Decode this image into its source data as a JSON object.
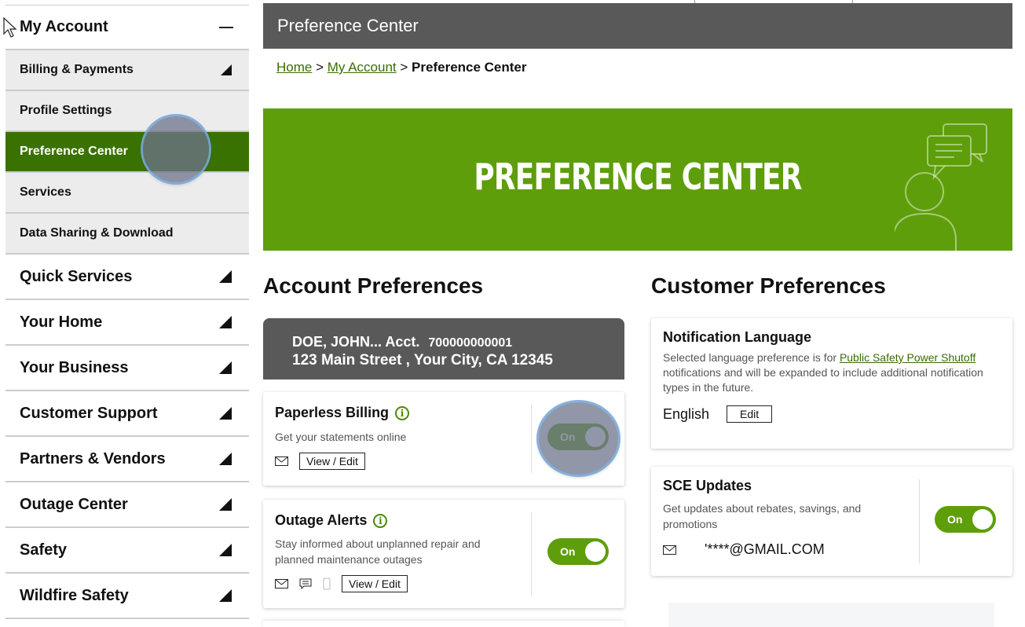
{
  "sidebar": {
    "account_title": "My Account",
    "sub_items": [
      {
        "label": "Billing & Payments"
      },
      {
        "label": "Profile Settings"
      },
      {
        "label": "Preference Center"
      },
      {
        "label": "Services"
      },
      {
        "label": "Data Sharing & Download"
      }
    ],
    "main_items": [
      {
        "label": "Quick Services"
      },
      {
        "label": "Your Home"
      },
      {
        "label": "Your Business"
      },
      {
        "label": "Customer Support"
      },
      {
        "label": "Partners & Vendors"
      },
      {
        "label": "Outage Center"
      },
      {
        "label": "Safety"
      },
      {
        "label": "Wildfire Safety"
      }
    ]
  },
  "header": {
    "title": "Preference Center"
  },
  "breadcrumb": {
    "home": "Home",
    "sep1": ">",
    "account": "My Account",
    "sep2": ">",
    "current": "Preference Center"
  },
  "banner": {
    "title": "PREFERENCE CENTER"
  },
  "account_prefs": {
    "title": "Account Preferences",
    "account": {
      "name": "DOE, JOHN... Acct.",
      "number": "700000000001",
      "address": "123 Main Street , Your City, CA 12345"
    },
    "paperless": {
      "title": "Paperless Billing",
      "desc": "Get your statements online",
      "button": "View / Edit",
      "toggle": "On"
    },
    "outage": {
      "title": "Outage Alerts",
      "desc": "Stay informed about unplanned repair and planned maintenance outages",
      "button": "View / Edit",
      "toggle": "On"
    }
  },
  "customer_prefs": {
    "title": "Customer Preferences",
    "language": {
      "title": "Notification Language",
      "desc_pre": "Selected language preference is for",
      "desc_link": "Public Safety Power Shutoff",
      "desc_post": "notifications and will be expanded to include additional notification types in the future.",
      "value": "English",
      "button": "Edit"
    },
    "updates": {
      "title": "SCE Updates",
      "desc": "Get updates about rebates, savings, and promotions",
      "email": "'****@GMAIL.COM",
      "toggle": "On"
    }
  },
  "colors": {
    "brand_green": "#5e9e0a",
    "dark_gray": "#595959",
    "active_green": "#3a7200"
  }
}
